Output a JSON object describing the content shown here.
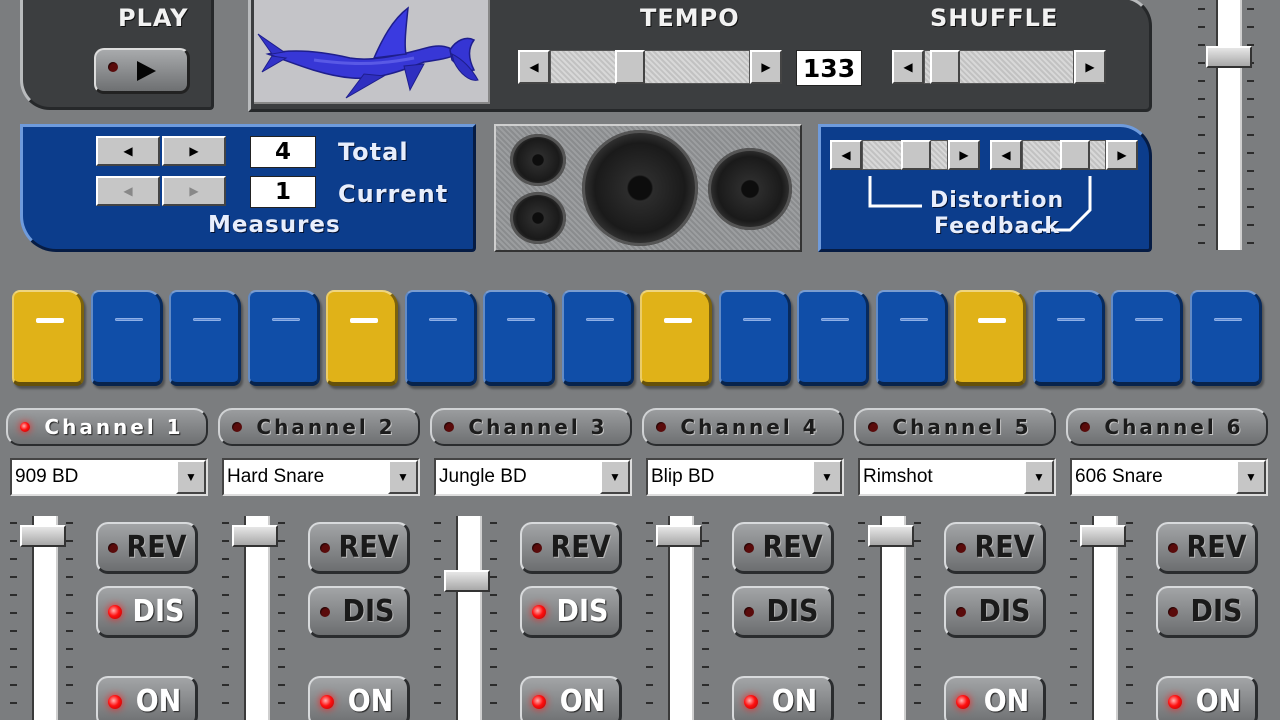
{
  "play": {
    "label": "PLAY",
    "icon": "play-icon"
  },
  "tempo": {
    "label": "TEMPO",
    "value": "133",
    "level": 0.38
  },
  "shuffle": {
    "label": "SHUFFLE",
    "level": 0.05
  },
  "measures": {
    "title": "Measures",
    "total_label": "Total",
    "total_value": "4",
    "current_label": "Current",
    "current_value": "1"
  },
  "effects": {
    "distortion_label": "Distortion",
    "feedback_label": "Feedback",
    "distortion_level": 0.7,
    "feedback_level": 0.7
  },
  "master_volume_level": 0.8,
  "steps": [
    {
      "active": true
    },
    {
      "active": false
    },
    {
      "active": false
    },
    {
      "active": false
    },
    {
      "active": true
    },
    {
      "active": false
    },
    {
      "active": false
    },
    {
      "active": false
    },
    {
      "active": true
    },
    {
      "active": false
    },
    {
      "active": false
    },
    {
      "active": false
    },
    {
      "active": true
    },
    {
      "active": false
    },
    {
      "active": false
    },
    {
      "active": false
    }
  ],
  "fx_labels": {
    "rev": "REV",
    "dis": "DIS",
    "on": "ON"
  },
  "channels": [
    {
      "name": "Channel 1",
      "selected": true,
      "sound": "909 BD",
      "rev": false,
      "dis": true,
      "on": true,
      "volume": 0.95
    },
    {
      "name": "Channel 2",
      "selected": false,
      "sound": "Hard Snare",
      "rev": false,
      "dis": false,
      "on": true,
      "volume": 0.95
    },
    {
      "name": "Channel 3",
      "selected": false,
      "sound": "Jungle BD",
      "rev": false,
      "dis": true,
      "on": true,
      "volume": 0.7
    },
    {
      "name": "Channel 4",
      "selected": false,
      "sound": "Blip BD",
      "rev": false,
      "dis": false,
      "on": true,
      "volume": 0.95
    },
    {
      "name": "Channel 5",
      "selected": false,
      "sound": "Rimshot",
      "rev": false,
      "dis": false,
      "on": true,
      "volume": 0.95
    },
    {
      "name": "Channel 6",
      "selected": false,
      "sound": "606 Snare",
      "rev": false,
      "dis": false,
      "on": true,
      "volume": 0.95
    }
  ],
  "colors": {
    "step_active": "#e0b218",
    "step_inactive": "#104ea8",
    "panel_blue": "#0c3d8c",
    "led_on": "#ff1010"
  }
}
